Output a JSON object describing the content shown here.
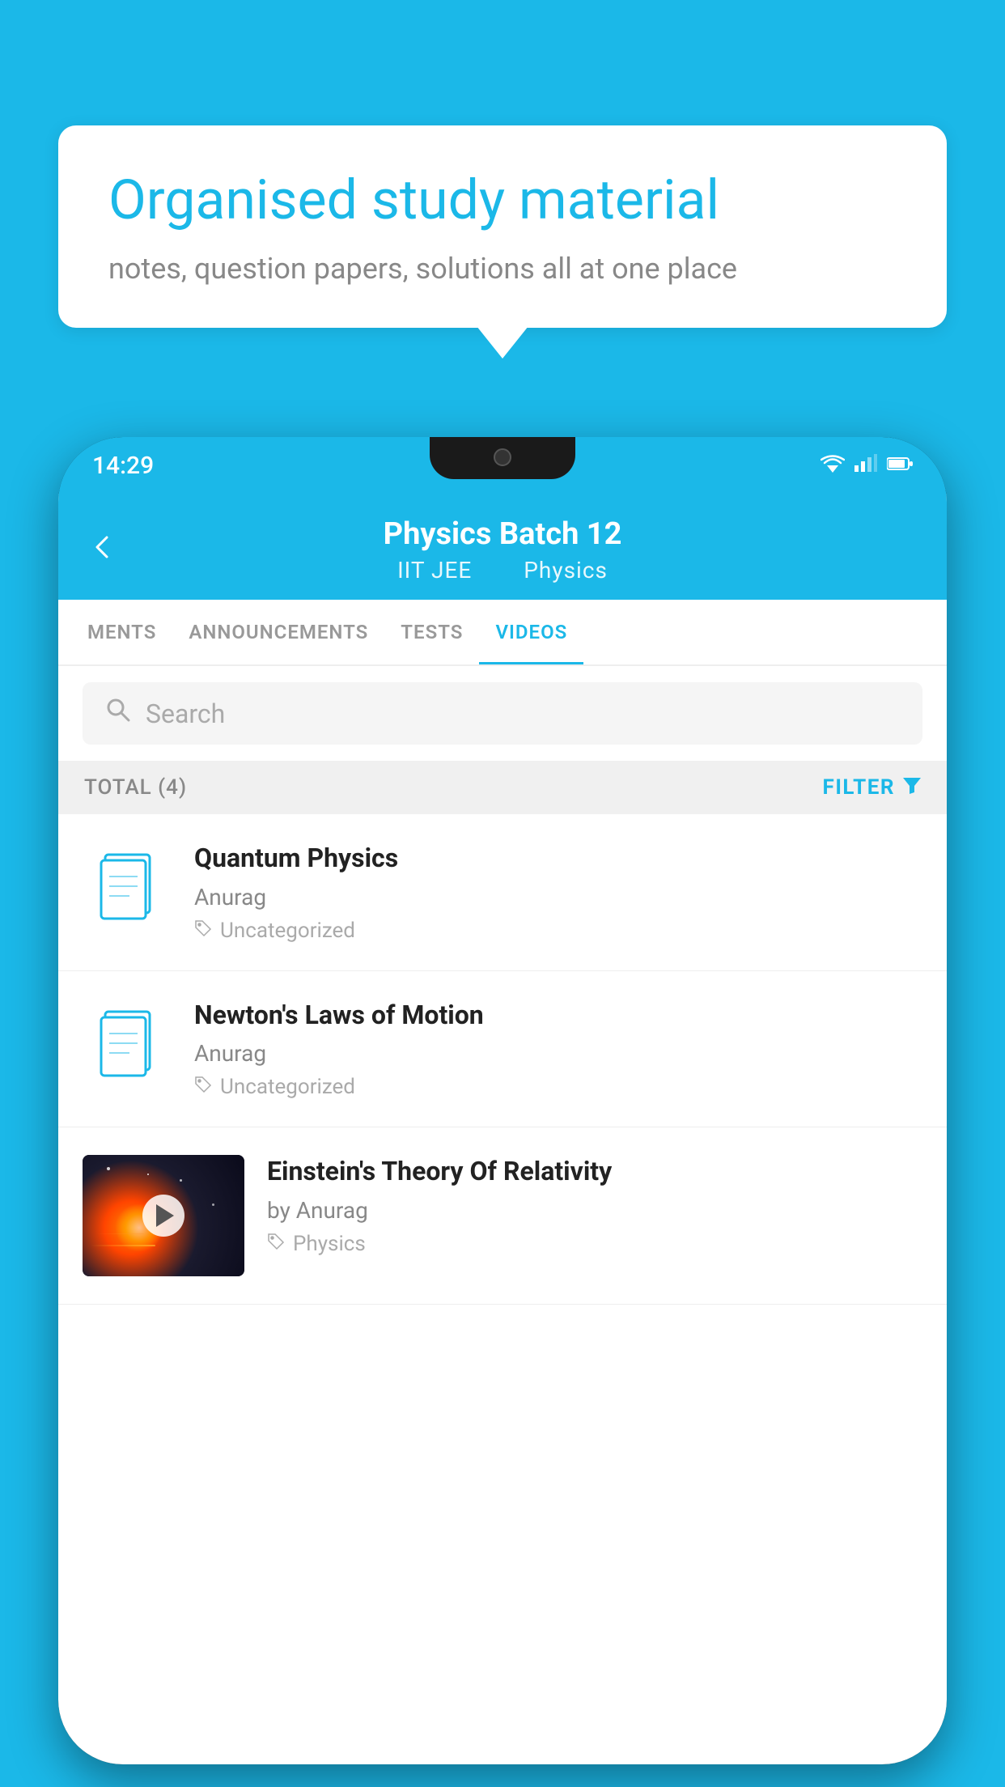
{
  "background": {
    "color": "#1BB8E8"
  },
  "speech_bubble": {
    "title": "Organised study material",
    "subtitle": "notes, question papers, solutions all at one place"
  },
  "phone": {
    "status_bar": {
      "time": "14:29"
    },
    "header": {
      "title": "Physics Batch 12",
      "subtitle_part1": "IIT JEE",
      "subtitle_part2": "Physics"
    },
    "tabs": [
      {
        "label": "MENTS",
        "active": false
      },
      {
        "label": "ANNOUNCEMENTS",
        "active": false
      },
      {
        "label": "TESTS",
        "active": false
      },
      {
        "label": "VIDEOS",
        "active": true
      }
    ],
    "search": {
      "placeholder": "Search"
    },
    "filter_bar": {
      "total_label": "TOTAL (4)",
      "filter_label": "FILTER"
    },
    "videos": [
      {
        "id": 1,
        "title": "Quantum Physics",
        "author": "Anurag",
        "tag": "Uncategorized",
        "has_thumbnail": false
      },
      {
        "id": 2,
        "title": "Newton's Laws of Motion",
        "author": "Anurag",
        "tag": "Uncategorized",
        "has_thumbnail": false
      },
      {
        "id": 3,
        "title": "Einstein's Theory Of Relativity",
        "author": "by Anurag",
        "tag": "Physics",
        "has_thumbnail": true
      }
    ]
  }
}
